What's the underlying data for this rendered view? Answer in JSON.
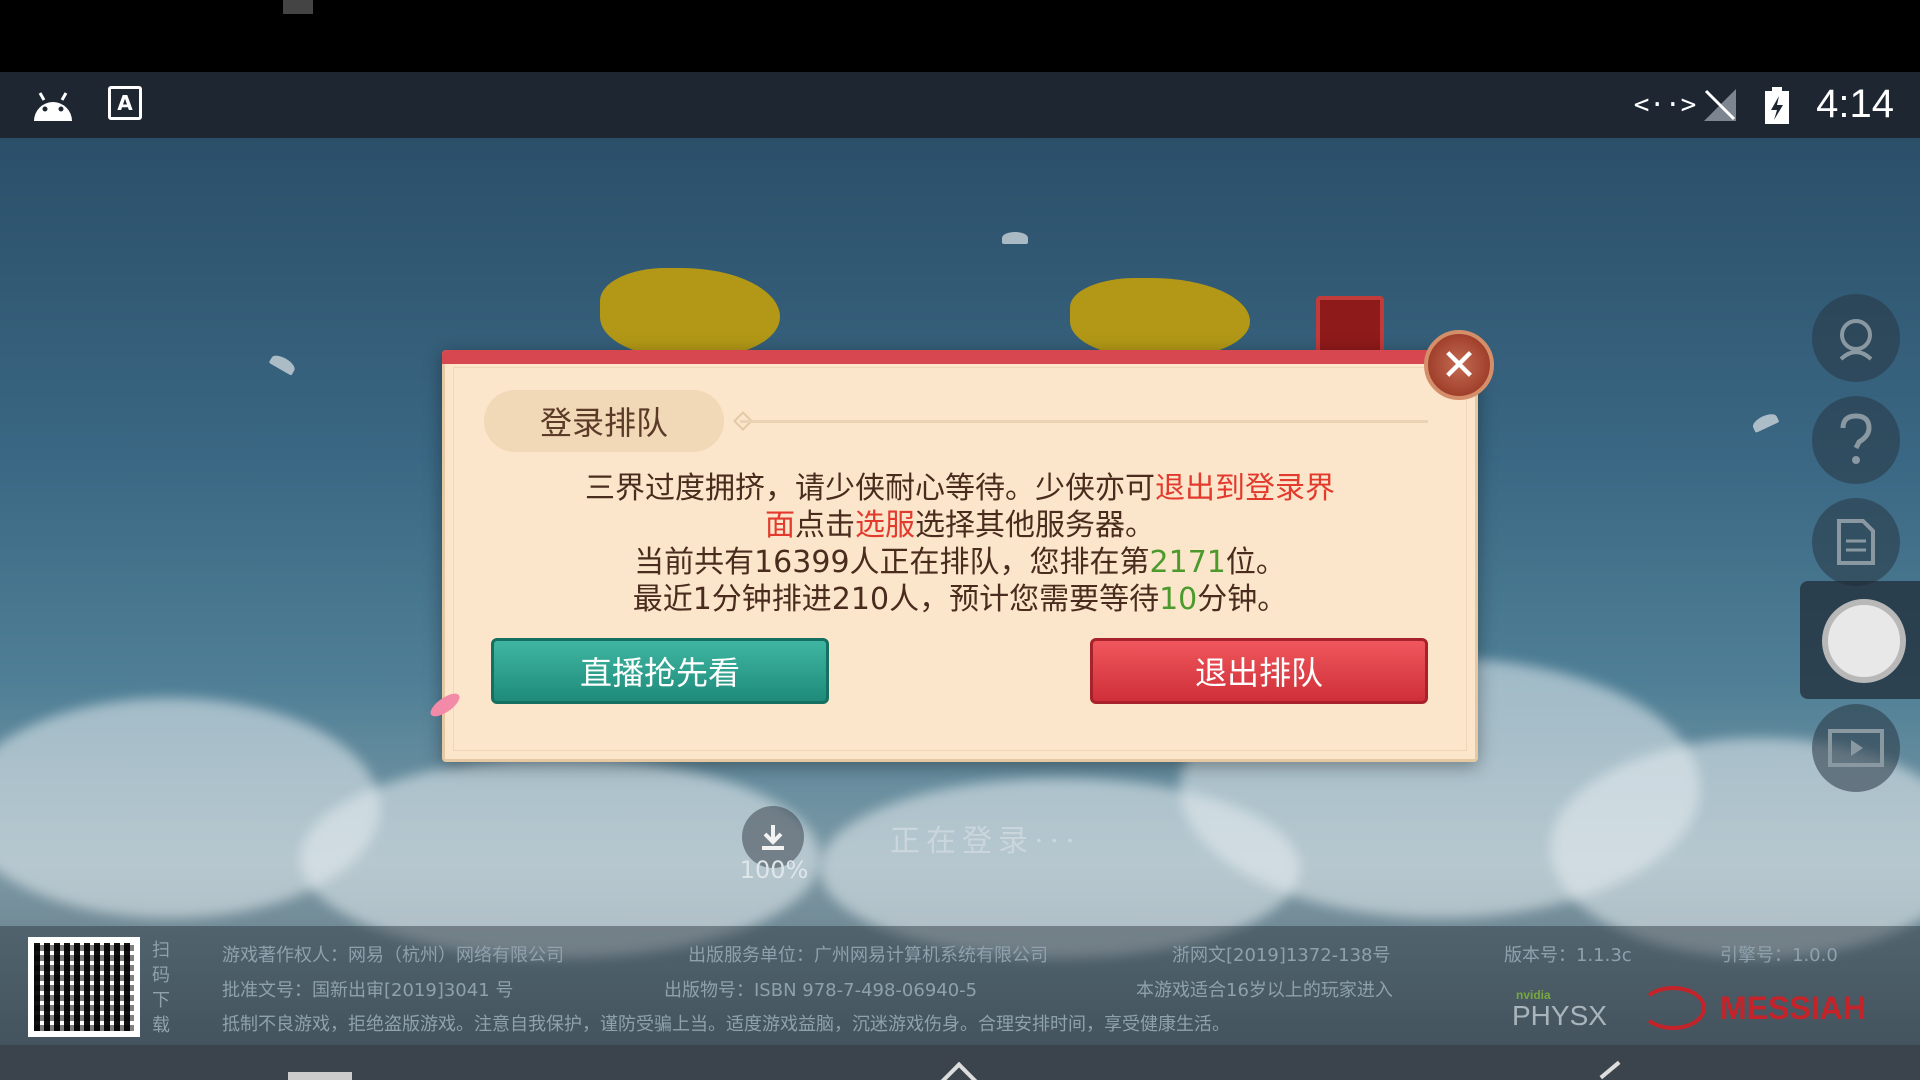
{
  "status_bar": {
    "time": "4:14",
    "a_icon_text": "A",
    "code_icon_text": "<··>",
    "icons": [
      "android-icon",
      "a-notification-icon",
      "code-icon",
      "no-signal-icon",
      "battery-charging-icon"
    ]
  },
  "dialog": {
    "tab_label": "登录排队",
    "line1_normal": "三界过度拥挤，请少侠耐心等待。少侠亦可",
    "line1_red": "退出到登录界",
    "line2_red_a": "面",
    "line2_normal_a": "点击",
    "line2_red_b": "选服",
    "line2_normal_b": "选择其他服务器。",
    "line3_a": "当前共有16399人正在排队，您排在第",
    "line3_rank": "2171",
    "line3_b": "位。",
    "line4_a": "最近1分钟排进210人，预计您需要等待",
    "line4_minutes": "10",
    "line4_b": "分钟。",
    "live_button": "直播抢先看",
    "exit_button": "退出排队",
    "close_symbol": "✕"
  },
  "loading": {
    "percent": "100%",
    "status": "正在登录···"
  },
  "footer": {
    "qr_label": "扫码下载",
    "copyright": "游戏著作权人：网易（杭州）网络有限公司",
    "publisher": "出版服务单位：广州网易计算机系统有限公司",
    "license_zj": "浙网文[2019]1372-138号",
    "version": "版本号：1.1.3c",
    "engine": "引擎号：1.0.0",
    "approval": "批准文号：国新出审[2019]3041 号",
    "isbn": "出版物号：ISBN 978-7-498-06940-5",
    "age": "本游戏适合16岁以上的玩家进入",
    "health": "抵制不良游戏，拒绝盗版游戏。注意自我保护，谨防受骗上当。适度游戏益脑，沉迷游戏伤身。合理安排时间，享受健康生活。",
    "physx": "PHYSX",
    "nvidia": "nvidia",
    "messiah": "MESSIAH"
  },
  "colors": {
    "red_text": "#e23b2e",
    "green_text": "#4b9a2b",
    "live_button": "#2aa08d",
    "exit_button": "#e0434b"
  }
}
